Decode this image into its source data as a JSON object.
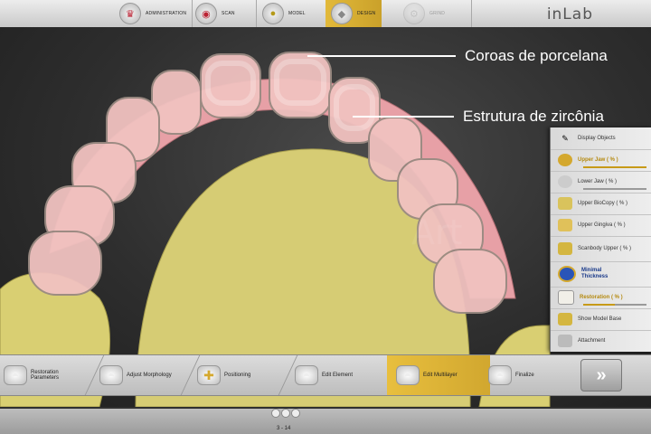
{
  "topbar": {
    "steps": [
      {
        "label": "ADMINISTRATION",
        "icon": "crown-icon"
      },
      {
        "label": "SCAN",
        "icon": "scan-icon"
      },
      {
        "label": "MODEL",
        "icon": "model-icon"
      },
      {
        "label": "DESIGN",
        "icon": "design-icon"
      },
      {
        "label": "GRIND",
        "icon": "grind-icon"
      }
    ],
    "brand": "inLab"
  },
  "annotations": {
    "crowns": "Coroas de porcelana",
    "framework": "Estrutura de zircônia"
  },
  "panel": {
    "items": [
      {
        "label": "Display Objects",
        "style": "normal"
      },
      {
        "label": "Upper Jaw  ( % )",
        "style": "gold",
        "slider": 1.0
      },
      {
        "label": "Lower Jaw  ( % )",
        "style": "normal",
        "slider": 0.0
      },
      {
        "label": "Upper BioCopy  ( % )",
        "style": "normal"
      },
      {
        "label": "Upper Gingiva  ( % )",
        "style": "normal"
      },
      {
        "label": "Scanbody Upper  ( % )",
        "style": "normal"
      },
      {
        "label": "Minimal Thickness",
        "style": "blue"
      },
      {
        "label": "Restoration  ( % )",
        "style": "gold",
        "slider": 0.5
      },
      {
        "label": "Show Model Base",
        "style": "normal"
      },
      {
        "label": "Attachment",
        "style": "normal"
      }
    ]
  },
  "workflow": {
    "steps": [
      {
        "label": "Restoration Parameters"
      },
      {
        "label": "Adjust Morphology"
      },
      {
        "label": "Positioning"
      },
      {
        "label": "Edit Element"
      },
      {
        "label": "Edit Multilayer"
      },
      {
        "label": "Finalize"
      }
    ],
    "next": "»"
  },
  "status": {
    "page": "3 - 14"
  },
  "colors": {
    "accent": "#d4a82e",
    "gingiva": "#e8a3a6",
    "model": "#d9cf7a"
  }
}
